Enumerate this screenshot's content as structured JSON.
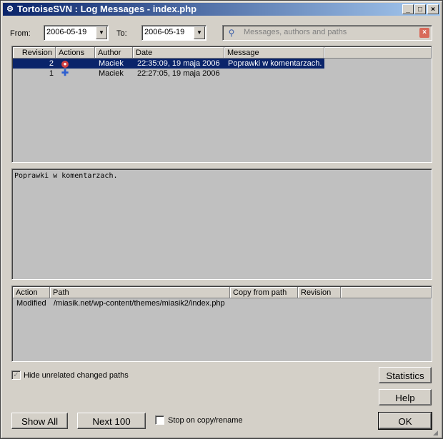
{
  "window": {
    "title": "TortoiseSVN : Log Messages - index.php"
  },
  "filters": {
    "from_label": "From:",
    "from_value": "2006-05-19",
    "to_label": "To:",
    "to_value": "2006-05-19",
    "search_placeholder": "Messages, authors and paths"
  },
  "log_table": {
    "columns": [
      "Revision",
      "Actions",
      "Author",
      "Date",
      "Message"
    ],
    "rows": [
      {
        "revision": "2",
        "action_icon": "modify-icon",
        "author": "Maciek",
        "date": "22:35:09, 19 maja 2006",
        "message": "Poprawki w komentarzach.",
        "selected": true
      },
      {
        "revision": "1",
        "action_icon": "add-icon",
        "author": "Maciek",
        "date": "22:27:05, 19 maja 2006",
        "message": "",
        "selected": false
      }
    ]
  },
  "message_panel": {
    "text": "Poprawki w komentarzach."
  },
  "paths_table": {
    "columns": [
      "Action",
      "Path",
      "Copy from path",
      "Revision"
    ],
    "rows": [
      {
        "action": "Modified",
        "path": "/miasik.net/wp-content/themes/miasik2/index.php",
        "copy_from": "",
        "revision": ""
      }
    ]
  },
  "options": {
    "hide_unrelated": "Hide unrelated changed paths",
    "hide_unrelated_checked": true,
    "stop_on_copy": "Stop on copy/rename",
    "stop_on_copy_checked": false
  },
  "buttons": {
    "statistics": "Statistics",
    "help": "Help",
    "show_all": "Show All",
    "next_100": "Next 100",
    "ok": "OK"
  }
}
